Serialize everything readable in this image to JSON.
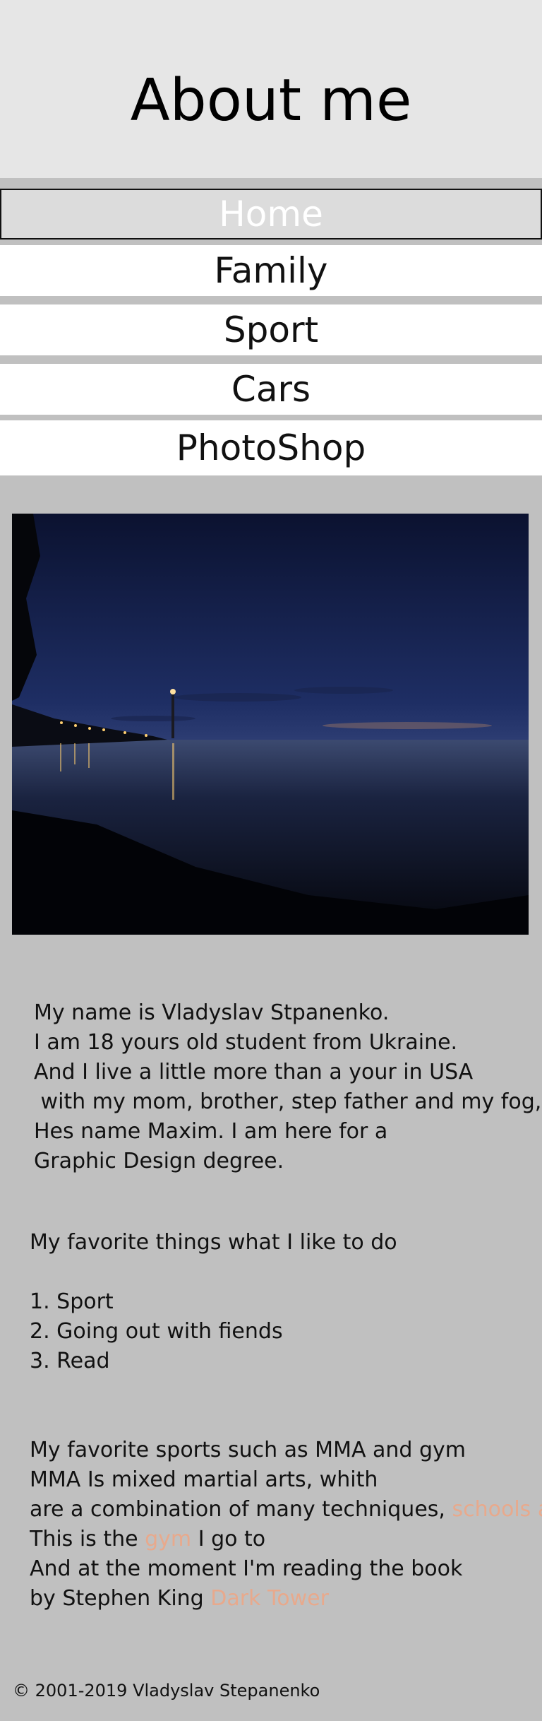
{
  "header": {
    "title": "About me",
    "bg_color": "#e6e6e6"
  },
  "nav": {
    "items": [
      {
        "label": "Home",
        "active": true
      },
      {
        "label": "Family",
        "active": false
      },
      {
        "label": "Sport",
        "active": false
      },
      {
        "label": "Cars",
        "active": false
      },
      {
        "label": "PhotoShop",
        "active": false
      }
    ]
  },
  "photo": {
    "icon": "night-lake-tower-photo"
  },
  "bio": {
    "lines": [
      "My name is Vladyslav Stpanenko.",
      "I am 18 yours old student from Ukraine.",
      "And I live a little more than a your in USA",
      " with my mom, brother, step father and my fog,",
      "Hes name Maxim. I am here for a",
      "Graphic Design degree."
    ]
  },
  "favorites": {
    "title": "My favorite things what I like to do",
    "items": [
      "1. Sport",
      "2. Going out with fiends",
      "3. Read"
    ]
  },
  "sports": {
    "line1": "My favorite sports such as MMA and gym",
    "line2": "MMA Is mixed martial arts, whith",
    "line3_text": "are a combination of many techniques, ",
    "line3_link": "schools and",
    "line4_pre": "This is the ",
    "line4_link": "gym",
    "line4_post": " I go to",
    "line5": "And at the moment I'm reading the book",
    "line6_pre": "by Stephen King ",
    "line6_link": "Dark Tower",
    "link_color": "#e8a98c"
  },
  "footer": {
    "text": "© 2001-2019 Vladyslav Stepanenko"
  },
  "colors": {
    "page_bg": "#c0c0c0",
    "nav_bg": "#ffffff",
    "active_nav_bg": "#dcdcdc"
  }
}
